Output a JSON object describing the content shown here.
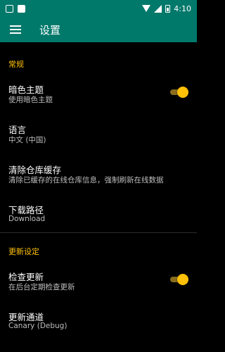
{
  "status_bar": {
    "time": "4:10",
    "icons": [
      "notification-icon",
      "photo-icon",
      "wifi-icon",
      "signal-icon",
      "battery-icon"
    ]
  },
  "toolbar": {
    "title": "设置",
    "menu_icon": "menu-icon"
  },
  "sections": {
    "general": {
      "header": "常规",
      "dark_theme": {
        "title": "暗色主题",
        "subtitle": "使用暗色主题",
        "enabled": true
      },
      "language": {
        "title": "语言",
        "subtitle": "中文 (中国)"
      },
      "clear_cache": {
        "title": "清除仓库缓存",
        "subtitle": "清除已缓存的在线仓库信息，强制刷新在线数据"
      },
      "download_path": {
        "title": "下载路径",
        "subtitle": "Download"
      }
    },
    "update": {
      "header": "更新设定",
      "check_update": {
        "title": "检查更新",
        "subtitle": "在后台定期检查更新",
        "enabled": true
      },
      "update_channel": {
        "title": "更新通道",
        "subtitle": "Canary (Debug)"
      }
    }
  },
  "colors": {
    "primary": "#00796b",
    "accent": "#ffc107",
    "background": "#000000"
  }
}
